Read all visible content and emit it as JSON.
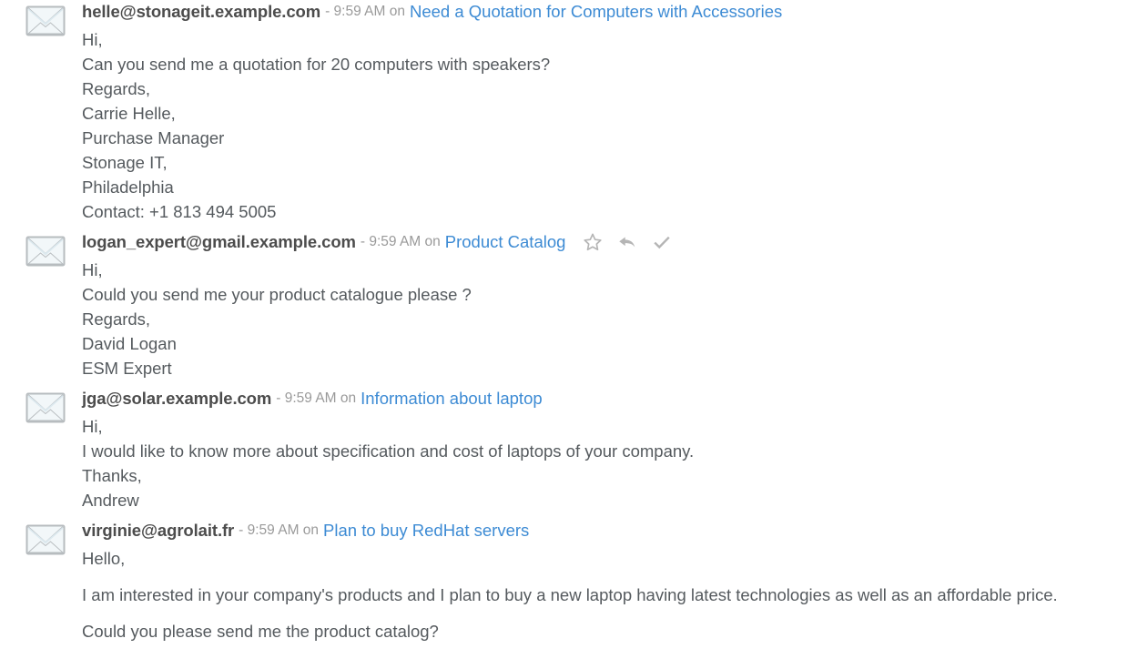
{
  "colors": {
    "background": "#ffffff",
    "author": "#4c4c4c",
    "meta": "#9a9a9a",
    "subject_link": "#3d8bd4",
    "body_text": "#555a5e",
    "icon_grey": "#b5b5b5",
    "envelope_border": "#b7bcbf",
    "envelope_fill": "#f2f7f9",
    "envelope_flap": "#dce9ef"
  },
  "messages": [
    {
      "icon": "envelope-icon",
      "author": "helle@stonageit.example.com",
      "meta": "- 9:59 AM on",
      "subject": "Need a Quotation for Computers with Accessories",
      "actions": [],
      "spaced": false,
      "lines": [
        "Hi,",
        "Can you send me a quotation for 20 computers with speakers?",
        "Regards,",
        "Carrie Helle,",
        "Purchase Manager",
        "Stonage IT,",
        "Philadelphia",
        "Contact: +1 813 494 5005"
      ]
    },
    {
      "icon": "envelope-icon",
      "author": "logan_expert@gmail.example.com",
      "meta": "- 9:59 AM on",
      "subject": "Product Catalog",
      "actions": [
        "star-icon",
        "reply-icon",
        "check-icon"
      ],
      "spaced": false,
      "lines": [
        "Hi,",
        "Could you send me your product catalogue please ?",
        "Regards,",
        "David Logan",
        "ESM Expert"
      ]
    },
    {
      "icon": "envelope-icon",
      "author": "jga@solar.example.com",
      "meta": "- 9:59 AM on",
      "subject": "Information about laptop",
      "actions": [],
      "spaced": false,
      "lines": [
        "Hi,",
        "I would like to know more about specification and cost of laptops of your company.",
        "Thanks,",
        "Andrew"
      ]
    },
    {
      "icon": "envelope-icon",
      "author": "virginie@agrolait.fr",
      "meta": "- 9:59 AM on",
      "subject": "Plan to buy RedHat servers",
      "actions": [],
      "spaced": true,
      "lines": [
        "Hello,",
        "I am interested in your company's products and I plan to buy a new laptop having latest technologies as well as an affordable price.",
        "Could you please send me the product catalog?"
      ]
    }
  ]
}
